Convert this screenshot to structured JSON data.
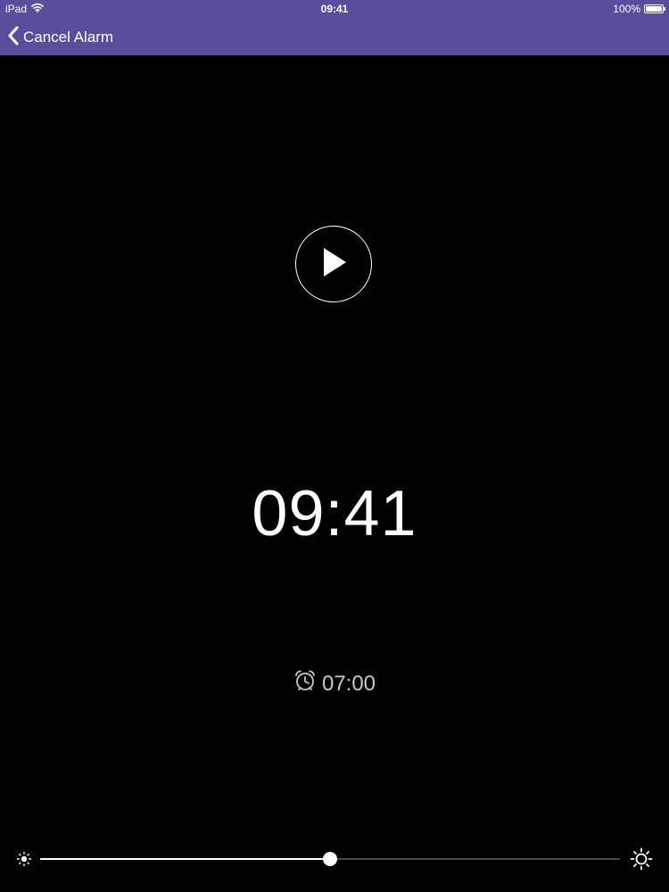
{
  "status_bar": {
    "device": "iPad",
    "time": "09:41",
    "battery": "100%",
    "battery_level": 1.0
  },
  "nav": {
    "back_label": "Cancel Alarm",
    "bar_color": "#5b4d9d"
  },
  "player": {
    "icon": "play-icon"
  },
  "clock": {
    "time": "09:41"
  },
  "alarm": {
    "icon": "alarm-clock-icon",
    "time": "07:00"
  },
  "brightness": {
    "level": 0.5,
    "min_icon": "sun-small-icon",
    "max_icon": "sun-large-icon"
  }
}
